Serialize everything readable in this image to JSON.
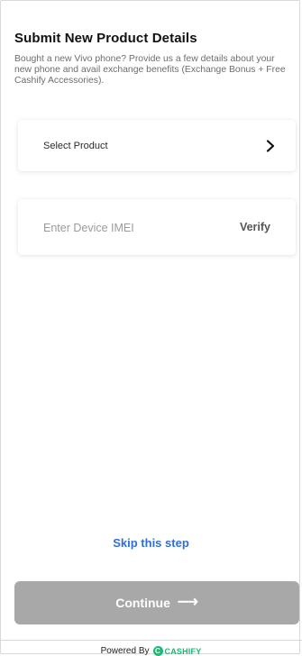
{
  "header": {
    "title": "Submit New Product Details",
    "subtitle": "Bought a new Vivo phone? Provide us a few details about your new phone and avail exchange benefits (Exchange Bonus + Free Cashify Accessories)."
  },
  "product_select": {
    "label": "Select Product",
    "icon": "chevron-right-icon"
  },
  "imei": {
    "placeholder": "Enter Device IMEI",
    "value": "",
    "verify_label": "Verify"
  },
  "actions": {
    "skip_label": "Skip this step",
    "continue_label": "Continue",
    "continue_icon": "arrow-right-icon"
  },
  "footer": {
    "powered_by": "Powered By",
    "brand_name": "CASHIFY",
    "brand_logo_letter": "C"
  },
  "colors": {
    "accent_blue": "#2f6fd6",
    "button_disabled": "#a8a8a8",
    "brand_green": "#1fb872"
  }
}
